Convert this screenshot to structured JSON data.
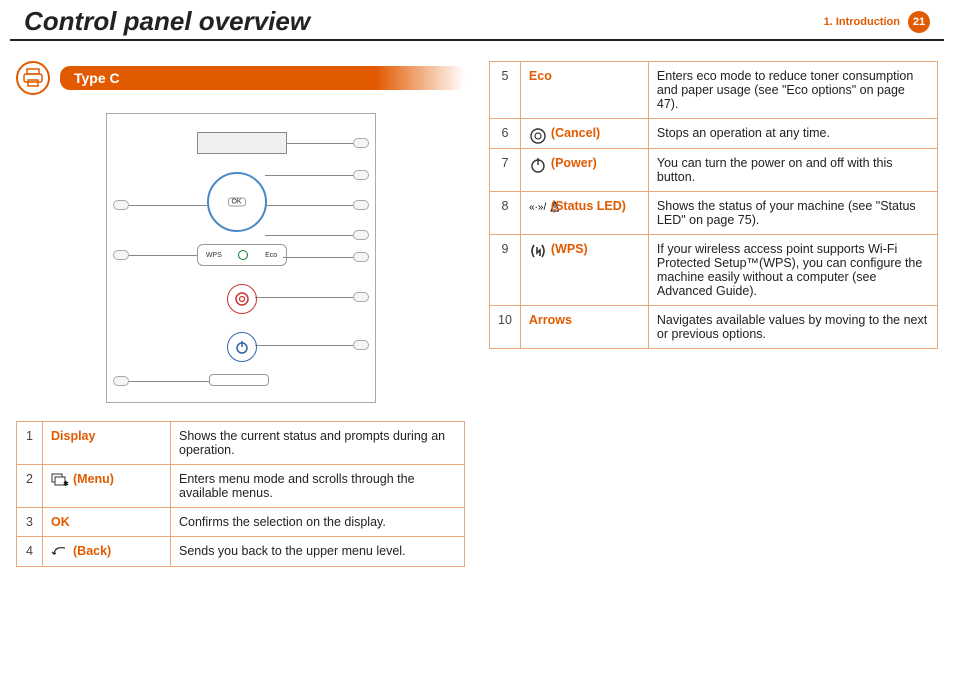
{
  "header": {
    "title": "Control panel overview",
    "chapter": "1.  Introduction",
    "page_number": "21"
  },
  "section": {
    "title": "Type C",
    "icon": "printer-icon"
  },
  "diagram": {
    "ok_label": "OK",
    "wps_label": "WPS",
    "eco_label": "Eco"
  },
  "rows_left": [
    {
      "num": "1",
      "label": "Display",
      "icon": null,
      "desc": "Shows the current status and prompts during an operation."
    },
    {
      "num": "2",
      "label": "(Menu)",
      "icon": "menu-icon",
      "desc": "Enters menu mode and scrolls through the available menus."
    },
    {
      "num": "3",
      "label": "OK",
      "icon": null,
      "desc": "Confirms the selection on the display."
    },
    {
      "num": "4",
      "label": "(Back)",
      "icon": "back-icon",
      "desc": "Sends you back to the upper menu level."
    }
  ],
  "rows_right": [
    {
      "num": "5",
      "label": "Eco",
      "icon": null,
      "desc": "Enters eco mode to reduce toner consumption and paper usage (see \"Eco options\" on page 47)."
    },
    {
      "num": "6",
      "label": "(Cancel)",
      "icon": "cancel-icon",
      "desc": "Stops an operation at any time."
    },
    {
      "num": "7",
      "label": "(Power)",
      "icon": "power-icon",
      "desc": "You can turn the power on and off with this button."
    },
    {
      "num": "8",
      "label": "(Status LED)",
      "icon": "status-icon",
      "desc": "Shows the status of your machine (see \"Status LED\" on page 75)."
    },
    {
      "num": "9",
      "label": "(WPS)",
      "icon": "wps-icon",
      "desc": "If your wireless access point supports Wi-Fi Protected Setup™(WPS), you can configure the machine easily without a computer (see Advanced Guide)."
    },
    {
      "num": "10",
      "label": "Arrows",
      "icon": null,
      "desc": "Navigates available values by moving to the next or previous options."
    }
  ]
}
